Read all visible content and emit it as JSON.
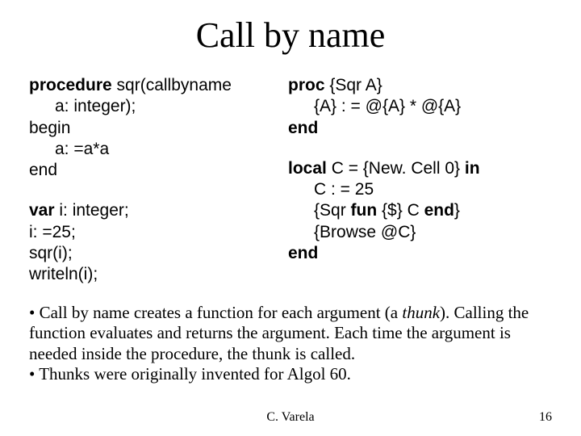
{
  "title": "Call by name",
  "left": {
    "l1a": "procedure",
    "l1b": " sqr(callbyname",
    "l2": "a: integer);",
    "l3": "begin",
    "l4": "a: =a*a",
    "l5": "end",
    "l6": "var",
    "l6b": " i: integer;",
    "l7": "i: =25;",
    "l8": "sqr(i);",
    "l9": "writeln(i);"
  },
  "right": {
    "r1a": "proc",
    "r1b": " {Sqr A}",
    "r2": "{A} : = @{A} * @{A}",
    "r3": "end",
    "r4a": "local",
    "r4b": " C = {New. Cell 0} ",
    "r4c": "in",
    "r5": "C : = 25",
    "r6a": "{Sqr ",
    "r6b": "fun",
    "r6c": " {$} C ",
    "r6d": "end",
    "r6e": "}",
    "r7": "{Browse @C}",
    "r8": "end"
  },
  "body": {
    "p1a": "• Call by name creates a function for each argument (a ",
    "p1b": "thunk",
    "p1c": ").  Calling the function evaluates and returns the argument.  Each time the argument is needed inside the procedure, the thunk is called.",
    "p2": "• Thunks were originally invented for Algol 60."
  },
  "footer": {
    "author": "C. Varela",
    "page": "16"
  }
}
